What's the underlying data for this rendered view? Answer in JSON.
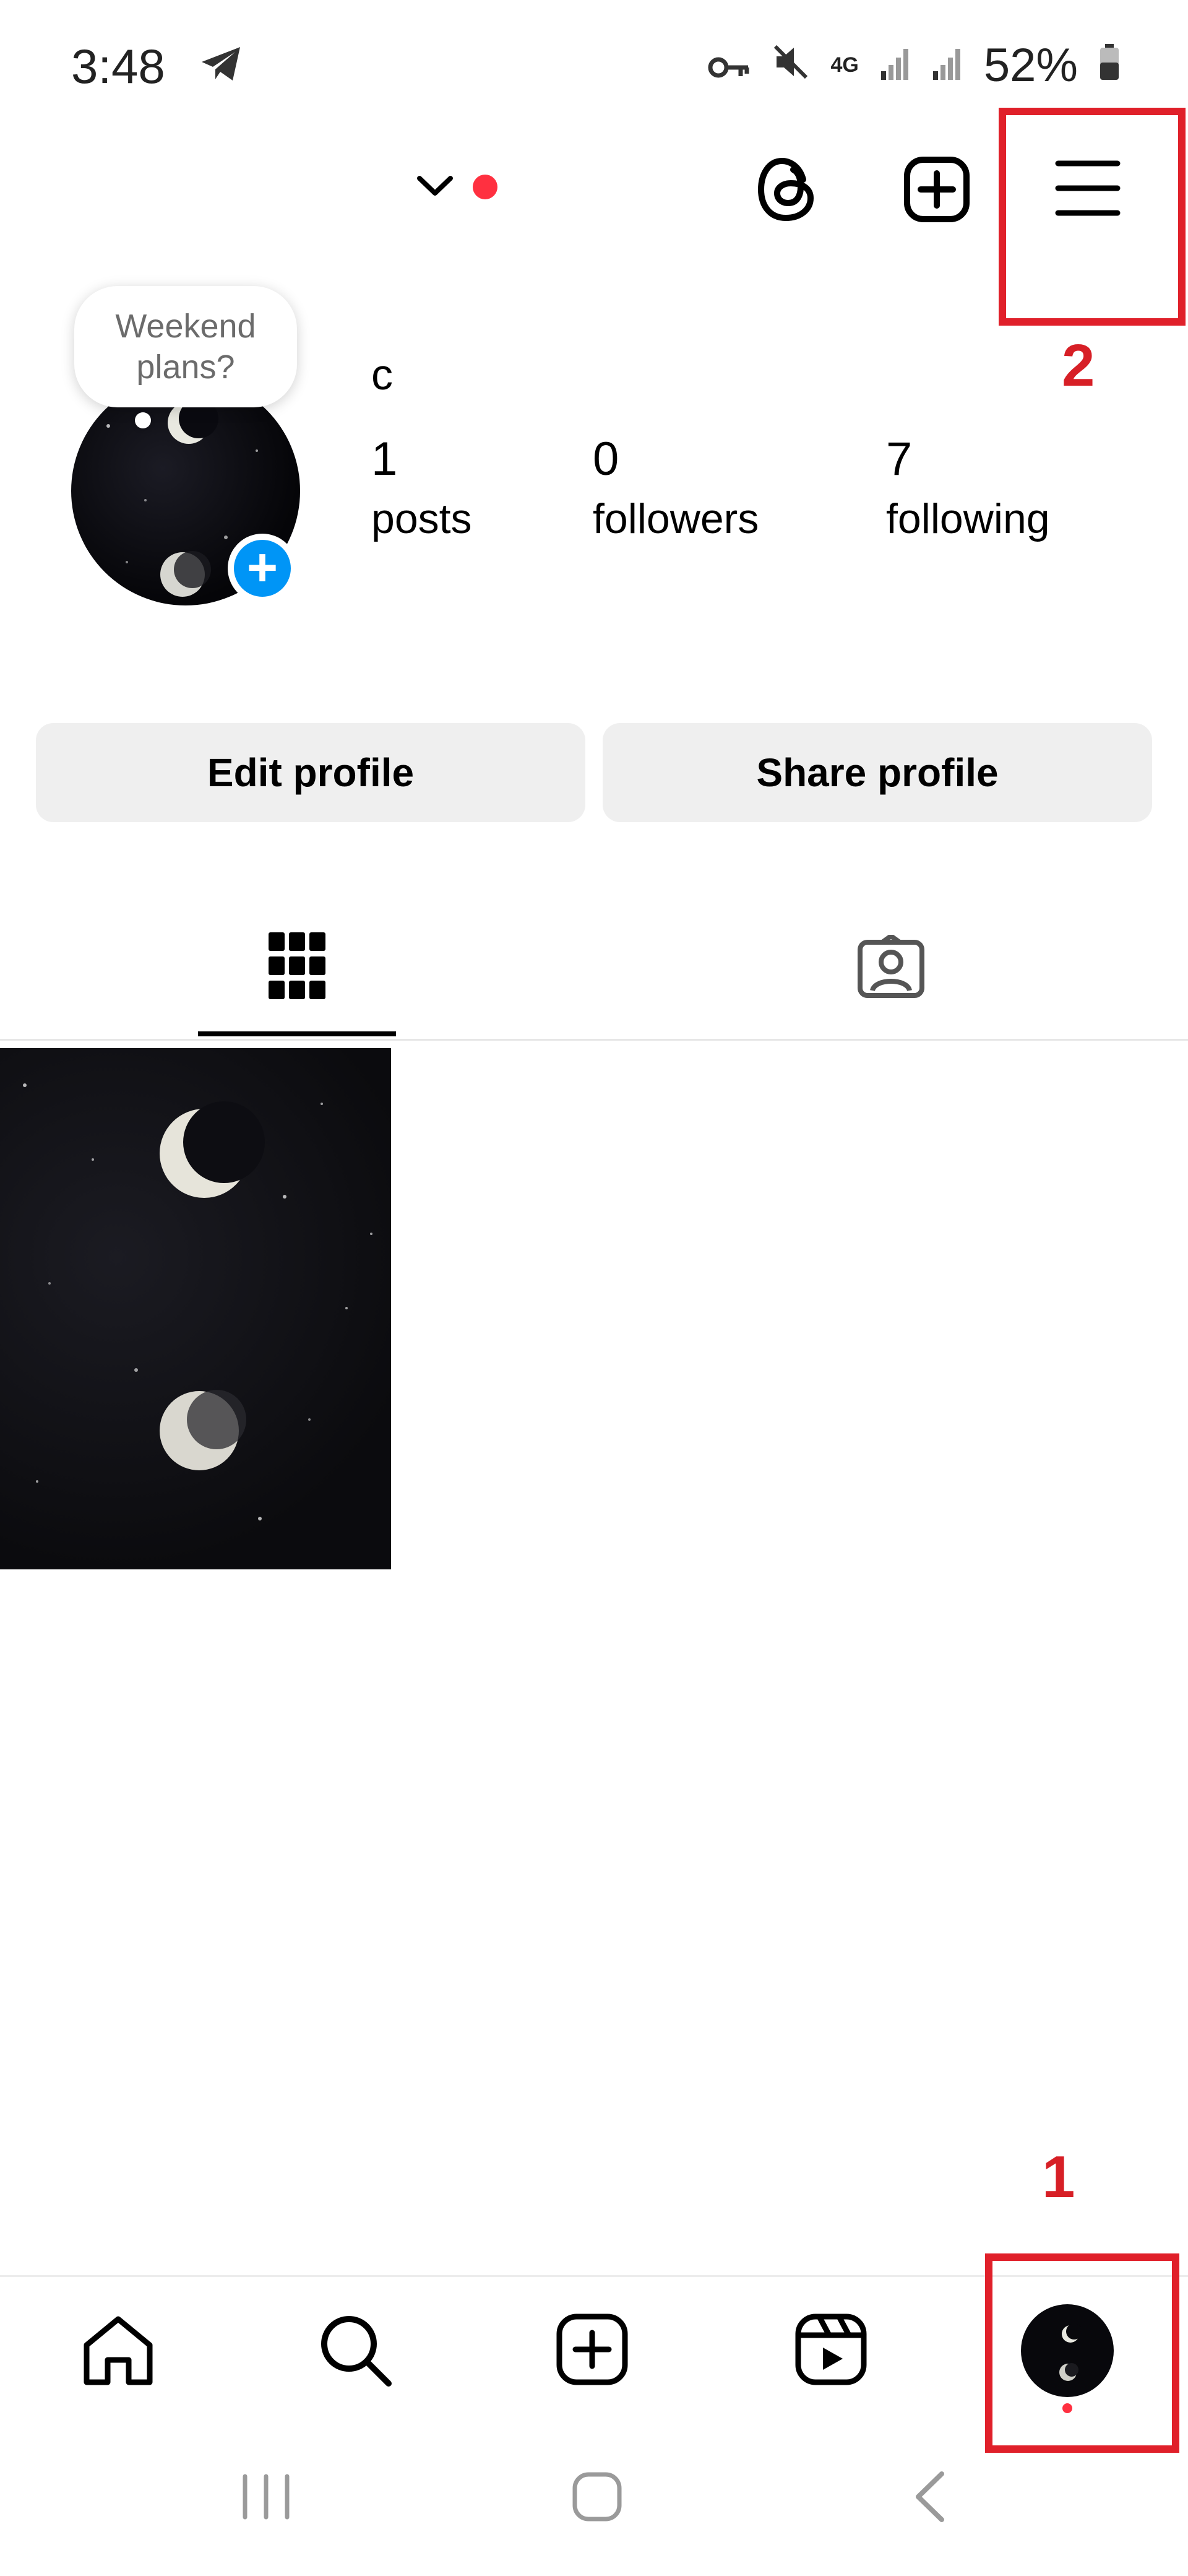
{
  "status_bar": {
    "time": "3:48",
    "network": "4G",
    "battery": "52%"
  },
  "profile": {
    "username": "c",
    "note_text_line1": "Weekend",
    "note_text_line2": "plans?",
    "stats": [
      {
        "value": "1",
        "label": "posts"
      },
      {
        "value": "0",
        "label": "followers"
      },
      {
        "value": "7",
        "label": "following"
      }
    ]
  },
  "actions": {
    "edit_profile": "Edit profile",
    "share_profile": "Share profile"
  },
  "annotations": {
    "marker_1": "1",
    "marker_2": "2",
    "color": "#e0202a"
  },
  "icons": {
    "top_bar": [
      "chevron-down-icon",
      "threads-icon",
      "create-plus-icon",
      "menu-icon"
    ],
    "tabs": [
      "grid-icon",
      "tagged-icon"
    ],
    "bottom_nav": [
      "home-icon",
      "search-icon",
      "create-icon",
      "reels-icon",
      "profile-avatar-icon"
    ],
    "system_nav": [
      "recents-icon",
      "home-button-icon",
      "back-icon"
    ]
  },
  "colors": {
    "accent_blue": "#0095f6",
    "notification_red": "#ff3040"
  }
}
